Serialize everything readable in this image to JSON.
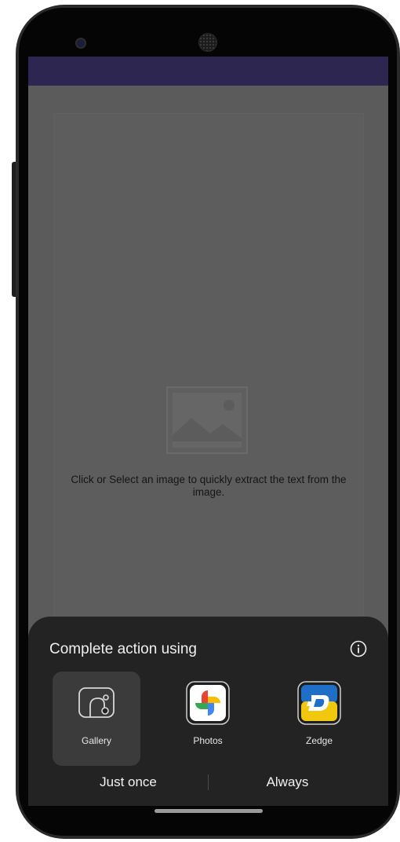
{
  "colors": {
    "app_bar": "#2d2650",
    "scrim": "#5b5b5b",
    "sheet_background": "#232323",
    "selected_option": "#3b3b3b",
    "text_primary": "#f0f0f0"
  },
  "main": {
    "placeholder_icon": "image-placeholder-icon",
    "instruction": "Click or Select an image to quickly extract the text from the image."
  },
  "sheet": {
    "title": "Complete action using",
    "info_icon": "info-icon",
    "apps": [
      {
        "label": "Gallery",
        "icon": "gallery-icon",
        "selected": true
      },
      {
        "label": "Photos",
        "icon": "photos-icon",
        "selected": false
      },
      {
        "label": "Zedge",
        "icon": "zedge-icon",
        "selected": false
      }
    ],
    "just_once_label": "Just once",
    "always_label": "Always"
  }
}
